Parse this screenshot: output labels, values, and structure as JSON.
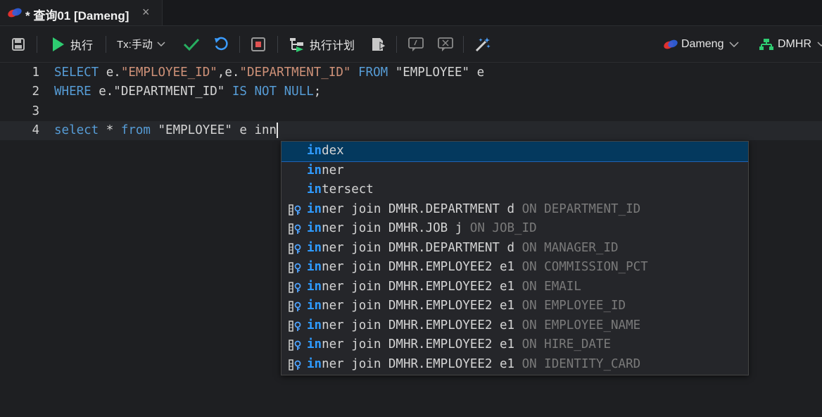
{
  "tab": {
    "title": "* 查询01 [Dameng]",
    "close": "×"
  },
  "toolbar": {
    "execute_label": "执行",
    "tx_label": "Tx:手动",
    "plan_label": "执行计划",
    "connection_label": "Dameng",
    "schema_label": "DMHR"
  },
  "editor": {
    "lines": [
      {
        "num": "1",
        "tokens": [
          {
            "t": "SELECT",
            "c": "kw"
          },
          {
            "t": " e.",
            "c": "plain"
          },
          {
            "t": "\"EMPLOYEE_ID\"",
            "c": "str"
          },
          {
            "t": ",e.",
            "c": "plain"
          },
          {
            "t": "\"DEPARTMENT_ID\"",
            "c": "str"
          },
          {
            "t": " ",
            "c": "plain"
          },
          {
            "t": "FROM",
            "c": "kw"
          },
          {
            "t": " \"EMPLOYEE\" e",
            "c": "plain"
          }
        ]
      },
      {
        "num": "2",
        "tokens": [
          {
            "t": "WHERE",
            "c": "kw"
          },
          {
            "t": " e.\"DEPARTMENT_ID\" ",
            "c": "plain"
          },
          {
            "t": "IS NOT NULL",
            "c": "kw"
          },
          {
            "t": ";",
            "c": "plain"
          }
        ]
      },
      {
        "num": "3",
        "tokens": []
      },
      {
        "num": "4",
        "tokens": [
          {
            "t": "select",
            "c": "kw"
          },
          {
            "t": " * ",
            "c": "plain"
          },
          {
            "t": "from",
            "c": "kw"
          },
          {
            "t": " \"EMPLOYEE\" e inn",
            "c": "plain"
          }
        ]
      }
    ]
  },
  "suggestions": [
    {
      "match": "in",
      "rest": "dex",
      "on": "",
      "col": "",
      "icon": false
    },
    {
      "match": "in",
      "rest": "ner",
      "on": "",
      "col": "",
      "icon": false
    },
    {
      "match": "in",
      "rest": "tersect",
      "on": "",
      "col": "",
      "icon": false
    },
    {
      "match": "in",
      "rest": "ner join DMHR.DEPARTMENT d ",
      "on": "ON",
      "col": " DEPARTMENT_ID",
      "icon": true
    },
    {
      "match": "in",
      "rest": "ner join DMHR.JOB j ",
      "on": "ON",
      "col": " JOB_ID",
      "icon": true
    },
    {
      "match": "in",
      "rest": "ner join DMHR.DEPARTMENT d ",
      "on": "ON",
      "col": " MANAGER_ID",
      "icon": true
    },
    {
      "match": "in",
      "rest": "ner join DMHR.EMPLOYEE2 e1 ",
      "on": "ON",
      "col": " COMMISSION_PCT",
      "icon": true
    },
    {
      "match": "in",
      "rest": "ner join DMHR.EMPLOYEE2 e1 ",
      "on": "ON",
      "col": " EMAIL",
      "icon": true
    },
    {
      "match": "in",
      "rest": "ner join DMHR.EMPLOYEE2 e1 ",
      "on": "ON",
      "col": " EMPLOYEE_ID",
      "icon": true
    },
    {
      "match": "in",
      "rest": "ner join DMHR.EMPLOYEE2 e1 ",
      "on": "ON",
      "col": " EMPLOYEE_NAME",
      "icon": true
    },
    {
      "match": "in",
      "rest": "ner join DMHR.EMPLOYEE2 e1 ",
      "on": "ON",
      "col": " HIRE_DATE",
      "icon": true
    },
    {
      "match": "in",
      "rest": "ner join DMHR.EMPLOYEE2 e1 ",
      "on": "ON",
      "col": " IDENTITY_CARD",
      "icon": true
    }
  ],
  "selected_suggestion": 0,
  "colors": {
    "keyword": "#569cd6",
    "string": "#ce9178",
    "match_highlight": "#2f9bff",
    "run_green": "#2ecc71",
    "check_green": "#27ae60",
    "undo_blue": "#3b9cff",
    "stop_red": "#e05252"
  },
  "icons": [
    "save-icon",
    "play-icon",
    "check-icon",
    "undo-icon",
    "stop-icon",
    "plan-icon",
    "format-icon",
    "comment-icon",
    "uncomment-icon",
    "magic-wand-icon",
    "dameng-logo-icon",
    "schema-icon",
    "chevron-down-icon",
    "close-icon",
    "column-icon"
  ]
}
